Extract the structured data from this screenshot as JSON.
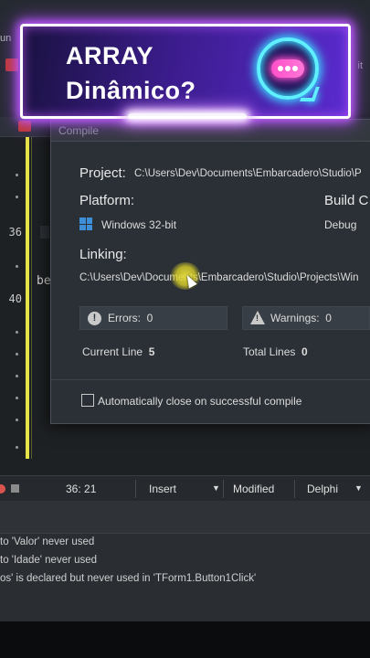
{
  "banner": {
    "line1": "ARRAY",
    "line2": "Dinâmico?",
    "icon": "chat-bubble-icon",
    "accent": "#5ff0ff"
  },
  "ide": {
    "menu_fragment": "un",
    "right_fragment": "it",
    "gutter_lines": [
      "36",
      "40"
    ],
    "editor_fragment": "be"
  },
  "compile_dialog": {
    "title": "Compile",
    "project_label": "Project:",
    "project_path": "C:\\Users\\Dev\\Documents\\Embarcadero\\Studio\\P",
    "platform_label": "Platform:",
    "platform_value": "Windows 32-bit",
    "build_label": "Build C",
    "build_value": "Debug",
    "linking_label": "Linking:",
    "linking_path": "C:\\Users\\Dev\\Documents\\Embarcadero\\Studio\\Projects\\Win",
    "errors_label": "Errors:",
    "errors_value": "0",
    "warnings_label": "Warnings:",
    "warnings_value": "0",
    "current_line_label": "Current Line",
    "current_line_value": "5",
    "total_lines_label": "Total Lines",
    "total_lines_value": "0",
    "auto_close_label": "Automatically close on successful compile",
    "auto_close_checked": false
  },
  "statusbar": {
    "position": "36: 21",
    "mode": "Insert",
    "modified": "Modified",
    "language": "Delphi"
  },
  "messages": [
    "to 'Valor' never used",
    "to 'Idade' never used",
    "os' is declared but never used in 'TForm1.Button1Click'"
  ]
}
